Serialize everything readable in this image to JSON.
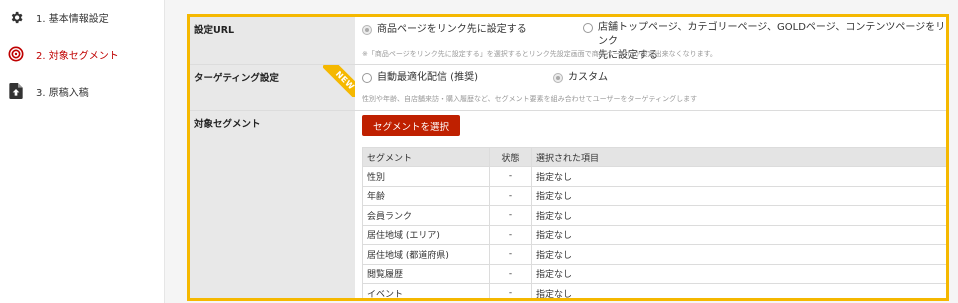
{
  "sidebar": {
    "steps": [
      {
        "label": "1. 基本情報設定",
        "icon": "gear-icon",
        "active": false
      },
      {
        "label": "2. 対象セグメント",
        "icon": "target-icon",
        "active": true
      },
      {
        "label": "3. 原稿入稿",
        "icon": "file-upload-icon",
        "active": false
      }
    ]
  },
  "form": {
    "url": {
      "label": "設定URL",
      "option_product": "商品ページをリンク先に設定する",
      "option_store_line1": "店舗トップページ、カテゴリーページ、GOLDページ、コンテンツページをリンク",
      "option_store_line2": "先に設定する",
      "note": "※「商品ページをリンク先に設定する」を選択するとリンク先設定画面で商品ページしか設定出来なくなります。",
      "selected": "product"
    },
    "targeting": {
      "label": "ターゲティング設定",
      "badge": "NEW",
      "option_auto": "自動最適化配信 (推奨)",
      "option_custom": "カスタム",
      "note": "性別や年齢、自店舗来訪・購入履歴など、セグメント要素を組み合わせてユーザーをターゲティングします",
      "selected": "custom"
    },
    "segment": {
      "label": "対象セグメント",
      "button": "セグメントを選択",
      "headers": [
        "セグメント",
        "状態",
        "選択された項目"
      ],
      "rows": [
        [
          "性別",
          "-",
          "指定なし"
        ],
        [
          "年齢",
          "-",
          "指定なし"
        ],
        [
          "会員ランク",
          "-",
          "指定なし"
        ],
        [
          "居住地域 (エリア)",
          "-",
          "指定なし"
        ],
        [
          "居住地域 (都道府県)",
          "-",
          "指定なし"
        ],
        [
          "閲覧履歴",
          "-",
          "指定なし"
        ],
        [
          "イベント",
          "-",
          "指定なし"
        ]
      ]
    }
  },
  "colors": {
    "accent": "#bf0000",
    "highlight": "#f5b800"
  }
}
